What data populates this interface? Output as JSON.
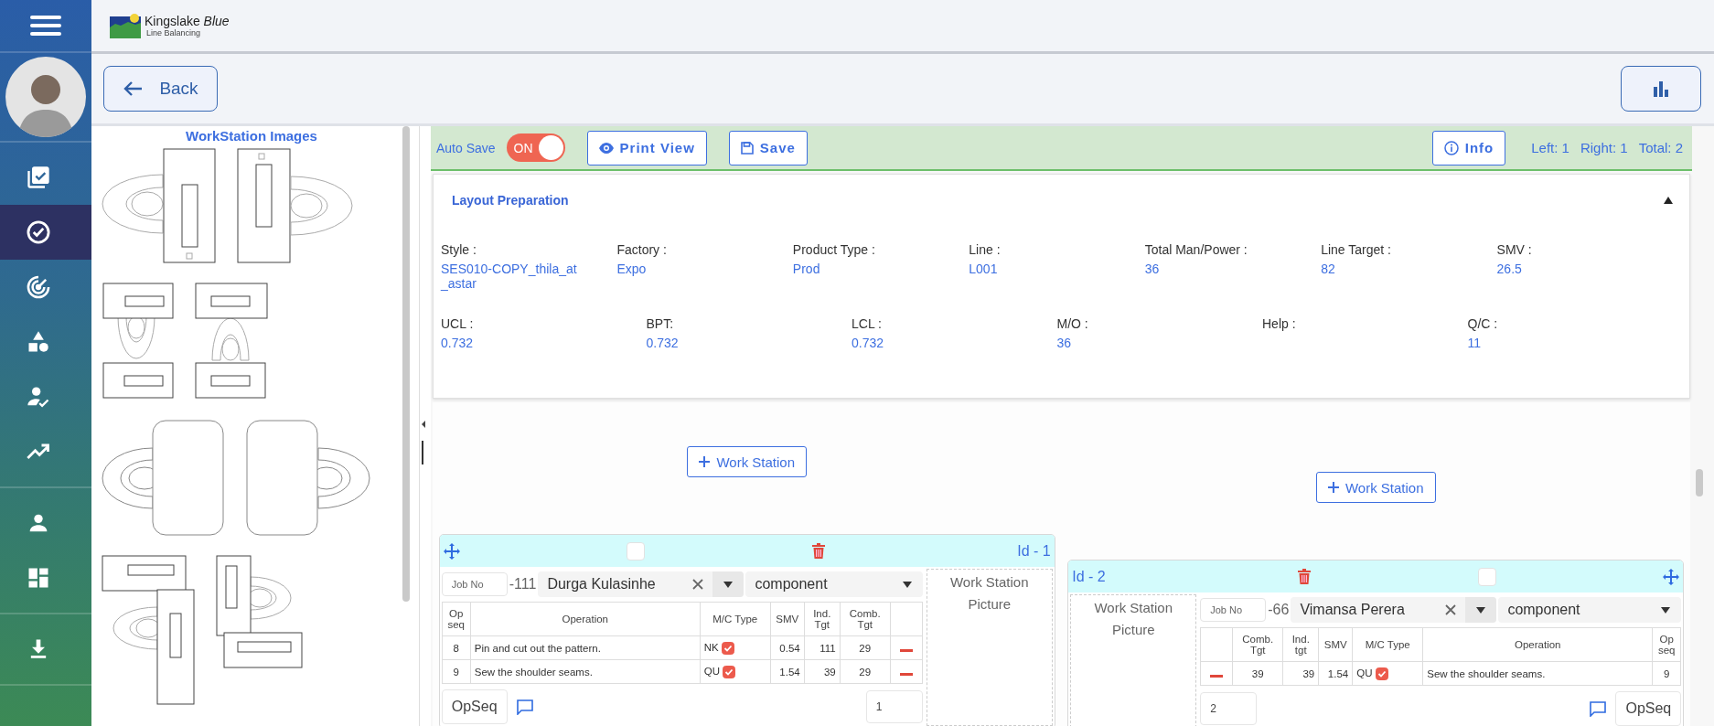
{
  "sidebar": {
    "groups": [
      [
        {
          "kind": "tasks",
          "selected": false
        },
        {
          "kind": "check",
          "selected": true
        },
        {
          "kind": "radar",
          "selected": false
        },
        {
          "kind": "shapes",
          "selected": false
        },
        {
          "kind": "user_check",
          "selected": false
        },
        {
          "kind": "trending",
          "selected": false
        }
      ],
      [
        {
          "kind": "person",
          "selected": false
        },
        {
          "kind": "dashboard",
          "selected": false
        }
      ],
      [
        {
          "kind": "download",
          "selected": false
        }
      ]
    ]
  },
  "header": {
    "logo": "Kingslake *Blue*",
    "subtitle": "Line Balancing"
  },
  "back_button": "Back",
  "workstation_images": {
    "title": "WorkStation Images"
  },
  "toolbar": {
    "auto_save_label": "Auto Save",
    "auto_save": {
      "on": true,
      "label": "ON"
    },
    "buttons": [
      {
        "kind": "print",
        "label": "Print View"
      },
      {
        "kind": "save",
        "label": "Save"
      }
    ],
    "info_button": "Info",
    "counts": [
      "Left: 1",
      "Right: 1",
      "Total: 2"
    ]
  },
  "layout": {
    "title": "Layout Preparation",
    "expanded": true,
    "rows": [
      [
        {
          "label": "Style :",
          "value": "SES010-COPY_thila_at_astar"
        },
        {
          "label": "Factory :",
          "value": "Expo"
        },
        {
          "label": "Product Type :",
          "value": "Prod"
        },
        {
          "label": "Line :",
          "value": "L001"
        },
        {
          "label": "Total Man/Power :",
          "value": "36"
        },
        {
          "label": "Line Target :",
          "value": "82"
        },
        {
          "label": "SMV :",
          "value": "26.5"
        }
      ],
      [
        {
          "label": "UCL :",
          "value": "0.732"
        },
        {
          "label": "BPT:",
          "value": "0.732"
        },
        {
          "label": "LCL :",
          "value": "0.732"
        },
        {
          "label": "M/O :",
          "value": "36"
        },
        {
          "label": "Help :"
        },
        {
          "label": "Q/C :",
          "value": "11"
        }
      ]
    ]
  },
  "workstations": [
    {
      "kind": "left",
      "button": "Work Station",
      "id_label": "Id - 1",
      "checked": false,
      "job_no_placeholder": "Job No",
      "job_suffix": "-111",
      "operator": "Durga Kulasinhe",
      "category": "component",
      "picture_label": "Work Station Picture",
      "columns": [
        {
          "kind": "op_seq",
          "label": "Op seq"
        },
        {
          "kind": "operation",
          "label": "Operation"
        },
        {
          "kind": "mc_type",
          "label": "M/C Type"
        },
        {
          "kind": "smv",
          "label": "SMV"
        },
        {
          "kind": "ind_tgt",
          "label": "Ind. Tgt"
        },
        {
          "kind": "comb_tgt",
          "label": "Comb. Tgt"
        },
        {
          "kind": "remove"
        }
      ],
      "rows": [
        {
          "op_seq": "8",
          "operation": "Pin and cut out the pattern.",
          "mc_type": "NK",
          "mc_checked": true,
          "smv": "0.54",
          "ind_tgt": "111",
          "comb_tgt": "29"
        },
        {
          "op_seq": "9",
          "operation": "Sew the shoulder seams.",
          "mc_type": "QU",
          "mc_checked": true,
          "smv": "1.54",
          "ind_tgt": "39",
          "comb_tgt": "29"
        }
      ],
      "opseq_button": "OpSeq",
      "count": "1"
    },
    {
      "kind": "right",
      "button": "Work Station",
      "id_label": "Id - 2",
      "checked": false,
      "job_no_placeholder": "Job No",
      "job_suffix": "-66",
      "operator": "Vimansa Perera",
      "category": "component",
      "picture_label": "Work Station Picture",
      "columns": [
        {
          "kind": "remove"
        },
        {
          "kind": "comb_tgt",
          "label": "Comb. Tgt"
        },
        {
          "kind": "ind_tgt",
          "label": "Ind. tgt"
        },
        {
          "kind": "smv",
          "label": "SMV"
        },
        {
          "kind": "mc_type",
          "label": "M/C Type"
        },
        {
          "kind": "operation",
          "label": "Operation"
        },
        {
          "kind": "op_seq",
          "label": "Op seq"
        }
      ],
      "rows": [
        {
          "op_seq": "9",
          "operation": "Sew the shoulder seams.",
          "mc_type": "QU",
          "mc_checked": true,
          "smv": "1.54",
          "ind_tgt": "39",
          "comb_tgt": "39"
        }
      ],
      "opseq_button": "OpSeq",
      "count": "2"
    }
  ]
}
